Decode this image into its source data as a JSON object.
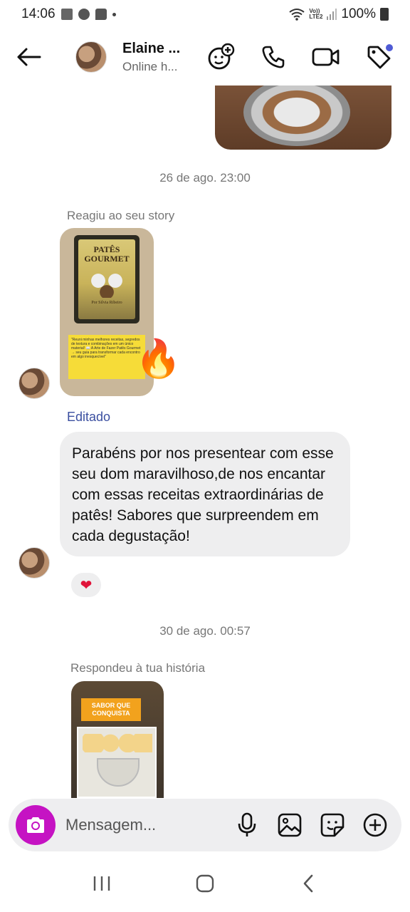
{
  "status_bar": {
    "time": "14:06",
    "volte": "Vo))\nLTE2",
    "battery": "100%"
  },
  "header": {
    "contact_name": "Elaine ...",
    "contact_status": "Online h..."
  },
  "chat": {
    "messages": [
      {
        "timestamp": "26 de ago. 23:00"
      },
      {
        "label": "Reagiu ao seu story",
        "story": {
          "book_title_line1": "PATÊS",
          "book_title_line2": "GOURMET",
          "book_author": "Por Silvia Ribeiro",
          "promo_text": "\"Reuni minhas melhores receitas, segredos de textura e combinações em um único material! 📖 A Arte de Fazer Patês Gourmet → seu guia para transformar cada encontro em algo inesquecível\""
        },
        "reaction": "🔥"
      },
      {
        "edited_label": "Editado",
        "text": "Parabéns por nos presentear com esse seu dom maravilhoso,de nos encantar com essas receitas extraordinárias de patês!  Sabores que surpreendem em cada degustação!",
        "reaction": "❤"
      },
      {
        "timestamp": "30 de ago. 00:57"
      },
      {
        "label": "Respondeu à tua história",
        "story": {
          "banner": "SABOR QUE CONQUISTA"
        }
      }
    ]
  },
  "composer": {
    "placeholder": "Mensagem..."
  },
  "colors": {
    "camera_button": "#c513c3",
    "edited_label": "#3b4fa0",
    "notification_dot": "#4f5bd5"
  }
}
